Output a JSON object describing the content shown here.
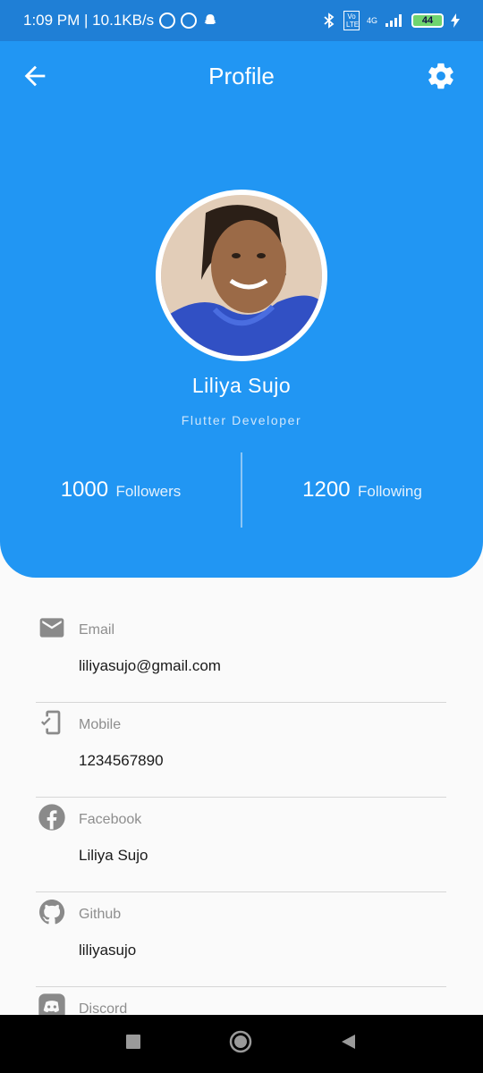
{
  "status_bar": {
    "time_speed": "1:09 PM | 10.1KB/s",
    "network": "4G",
    "volte": "Vo LTE",
    "battery": "44"
  },
  "appbar": {
    "title": "Profile"
  },
  "profile": {
    "name": "Liliya Sujo",
    "role": "Flutter Developer"
  },
  "stats": {
    "followers_count": "1000",
    "followers_label": "Followers",
    "following_count": "1200",
    "following_label": "Following"
  },
  "details": [
    {
      "icon": "email-icon",
      "label": "Email",
      "value": "liliyasujo@gmail.com"
    },
    {
      "icon": "mobile-icon",
      "label": "Mobile",
      "value": "1234567890"
    },
    {
      "icon": "facebook-icon",
      "label": "Facebook",
      "value": "Liliya Sujo"
    },
    {
      "icon": "github-icon",
      "label": "Github",
      "value": "liliyasujo"
    },
    {
      "icon": "discord-icon",
      "label": "Discord",
      "value": ""
    }
  ],
  "colors": {
    "primary": "#2196f3",
    "status_bar": "#1f7fd6",
    "background": "#fafafa"
  }
}
